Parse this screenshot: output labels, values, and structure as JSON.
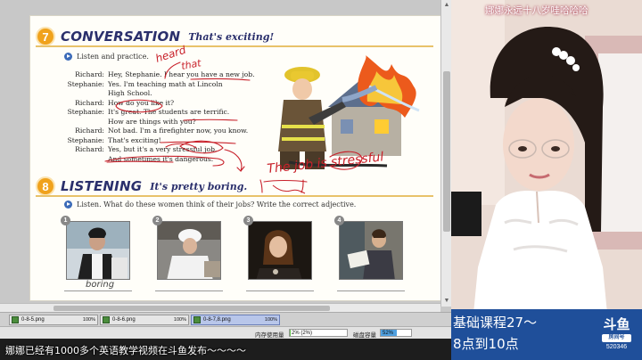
{
  "textbook": {
    "section7": {
      "number": "7",
      "title": "CONVERSATION",
      "subtitle": "That's exciting!",
      "instruction": "Listen and practice.",
      "dialog": [
        {
          "speaker": "Richard:",
          "line": "Hey, Stephanie. I hear you have a new job."
        },
        {
          "speaker": "Stephanie:",
          "line": "Yes. I'm teaching math at Lincoln"
        },
        {
          "speaker": "",
          "line": "High School."
        },
        {
          "speaker": "Richard:",
          "line": "How do you like it?"
        },
        {
          "speaker": "Stephanie:",
          "line": "It's great. The students are terrific."
        },
        {
          "speaker": "",
          "line": "How are things with you?"
        },
        {
          "speaker": "Richard:",
          "line": "Not bad. I'm a firefighter now, you know."
        },
        {
          "speaker": "Stephanie:",
          "line": "That's exciting!"
        },
        {
          "speaker": "Richard:",
          "line": "Yes, but it's a very stressful job."
        },
        {
          "speaker": "",
          "line": "And sometimes it's dangerous."
        }
      ]
    },
    "section8": {
      "number": "8",
      "title": "LISTENING",
      "subtitle": "It's pretty boring.",
      "instruction": "Listen. What do these women think of their jobs? Write the correct adjective.",
      "photo_numbers": [
        "1",
        "2",
        "3",
        "4"
      ],
      "answer_1": "boring"
    },
    "handwriting": {
      "heard": "heard",
      "that": "that",
      "phrase": "The job is stressful"
    }
  },
  "thumbnails": [
    {
      "name": "0-8-5.png",
      "zoom": "100%",
      "active": false
    },
    {
      "name": "0-8-6.png",
      "zoom": "100%",
      "active": false
    },
    {
      "name": "0-8-7,8.png",
      "zoom": "100%",
      "active": true
    }
  ],
  "status": {
    "memory_label": "内存使用量",
    "memory_value": "2% (2%)",
    "memory_fraction": 0.02,
    "disk_label": "磁盘容量",
    "disk_value": "52%",
    "disk_fraction": 0.52
  },
  "danmaku": "娜娜已经有1000多个英语教学视频在斗鱼发布～～～～",
  "stream": {
    "top_caption": "娜娜永远十八岁哇哈哈哈",
    "promo_line1": "基础课程27～",
    "promo_line2": "8点到10点",
    "logo_text": "斗鱼",
    "logo_badge": "房间号",
    "room_number": "520346"
  },
  "colors": {
    "accent_orange": "#f0a21c",
    "title_navy": "#2a2f6c",
    "annotation_red": "#c8202a",
    "promo_blue": "#1f4f9a"
  }
}
